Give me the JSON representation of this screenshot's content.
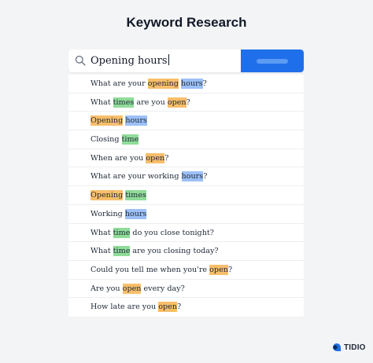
{
  "page": {
    "title": "Keyword Research"
  },
  "search": {
    "value": "Opening hours",
    "icon": "search-icon"
  },
  "colors": {
    "button": "#1f6fea",
    "highlight_orange": "#f8be6a",
    "highlight_blue": "#9cc0f7",
    "highlight_green": "#8fdc99"
  },
  "suggestions": [
    [
      {
        "t": "What are your "
      },
      {
        "t": "opening",
        "hl": "orange"
      },
      {
        "t": " "
      },
      {
        "t": "hours",
        "hl": "blue"
      },
      {
        "t": "?"
      }
    ],
    [
      {
        "t": "What "
      },
      {
        "t": "times",
        "hl": "green"
      },
      {
        "t": " are you "
      },
      {
        "t": "open",
        "hl": "orange"
      },
      {
        "t": "?"
      }
    ],
    [
      {
        "t": "Opening",
        "hl": "orange"
      },
      {
        "t": " "
      },
      {
        "t": "hours",
        "hl": "blue"
      }
    ],
    [
      {
        "t": "Closing "
      },
      {
        "t": "time",
        "hl": "green"
      }
    ],
    [
      {
        "t": "When are you "
      },
      {
        "t": "open",
        "hl": "orange"
      },
      {
        "t": "?"
      }
    ],
    [
      {
        "t": "What are your working "
      },
      {
        "t": "hours",
        "hl": "blue"
      },
      {
        "t": "?"
      }
    ],
    [
      {
        "t": "Opening",
        "hl": "orange"
      },
      {
        "t": " "
      },
      {
        "t": "times",
        "hl": "green"
      }
    ],
    [
      {
        "t": "Working "
      },
      {
        "t": "hours",
        "hl": "blue"
      }
    ],
    [
      {
        "t": "What "
      },
      {
        "t": "time",
        "hl": "green"
      },
      {
        "t": " do you close tonight?"
      }
    ],
    [
      {
        "t": "What "
      },
      {
        "t": "time",
        "hl": "green"
      },
      {
        "t": " are you closing today?"
      }
    ],
    [
      {
        "t": "Could you tell me when you're "
      },
      {
        "t": "open",
        "hl": "orange"
      },
      {
        "t": "?"
      }
    ],
    [
      {
        "t": "Are you "
      },
      {
        "t": "open",
        "hl": "orange"
      },
      {
        "t": " every day?"
      }
    ],
    [
      {
        "t": "How late are you "
      },
      {
        "t": "open",
        "hl": "orange"
      },
      {
        "t": "?"
      }
    ]
  ],
  "brand": {
    "name": "TIDIO",
    "icon": "tidio-logo-icon"
  }
}
